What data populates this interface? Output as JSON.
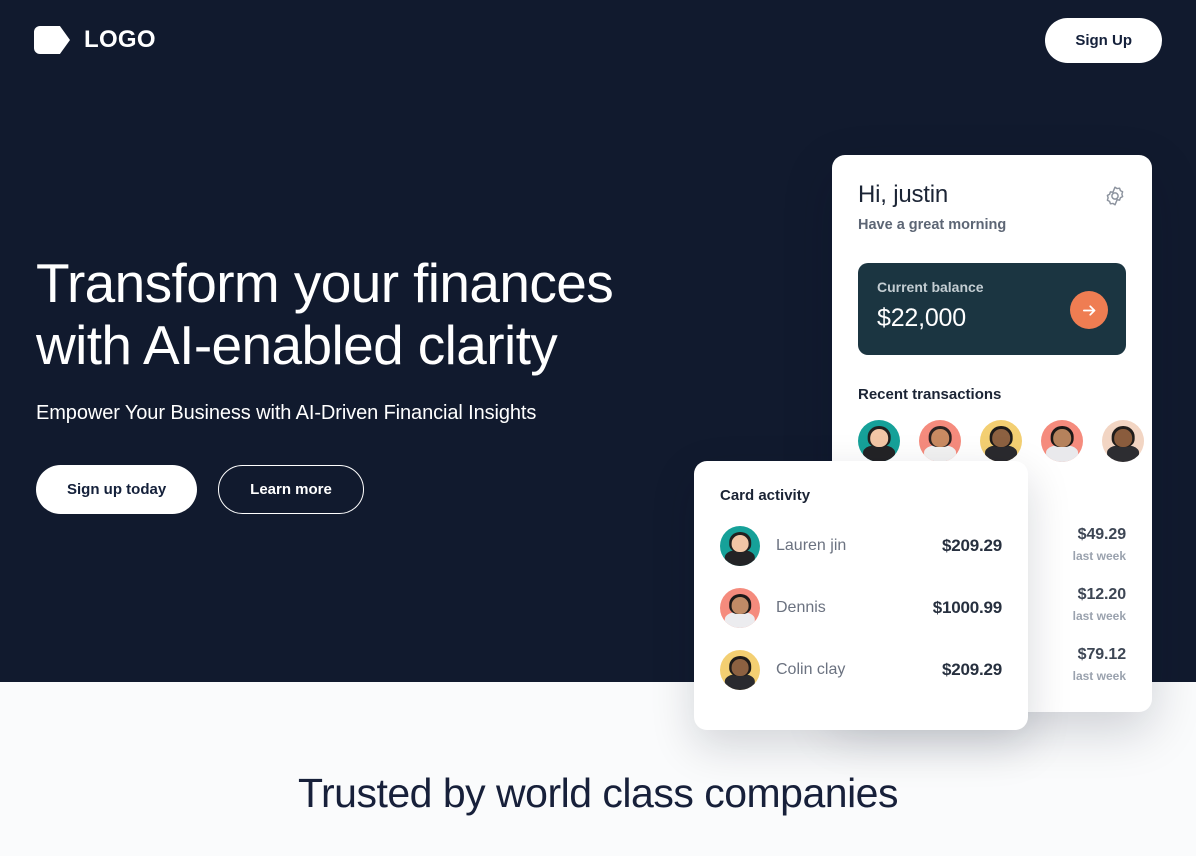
{
  "navbar": {
    "logo_icon": "tag-logo-icon",
    "brand_name": "LOGO",
    "signup_label": "Sign Up"
  },
  "hero": {
    "title_line1": "Transform your finances",
    "title_line2": "with AI-enabled clarity",
    "subtitle": "Empower Your Business with AI-Driven Financial Insights",
    "primary_cta": "Sign up today",
    "secondary_cta": "Learn more",
    "background_color": "#111a2e"
  },
  "dashboard_card": {
    "greeting": "Hi, justin",
    "greeting_sub": "Have a great morning",
    "settings_icon": "gear-icon",
    "balance": {
      "label": "Current balance",
      "value": "$22,000",
      "card_color": "#1b3541",
      "arrow_icon": "arrow-right-icon",
      "arrow_color": "#ef7d52"
    },
    "recent_title": "Recent transactions",
    "avatars": [
      {
        "name": "avatar-1",
        "bg": "#16a199",
        "skin": "#f2c6a6",
        "hair": "#22201f",
        "shirt": "#232326"
      },
      {
        "name": "avatar-2",
        "bg": "#f58b7d",
        "skin": "#c98b62",
        "hair": "#2b2322",
        "shirt": "#f2f2f2"
      },
      {
        "name": "avatar-3",
        "bg": "#f3cf72",
        "skin": "#8c6141",
        "hair": "#1d1b1a",
        "shirt": "#2a2a2e"
      },
      {
        "name": "avatar-4",
        "bg": "#f58b7d",
        "skin": "#b5825c",
        "hair": "#1b1817",
        "shirt": "#e9e9ec"
      },
      {
        "name": "avatar-5",
        "bg": "#f2d5c3",
        "skin": "#8a5c3d",
        "hair": "#211d1b",
        "shirt": "#2d2d31"
      }
    ],
    "amounts": [
      {
        "value": "$49.29",
        "note": "last week"
      },
      {
        "value": "$12.20",
        "note": "last week"
      },
      {
        "value": "$79.12",
        "note": "last week"
      }
    ]
  },
  "activity_card": {
    "title": "Card activity",
    "rows": [
      {
        "name": "Lauren jin",
        "amount": "$209.29",
        "avatar": {
          "name": "avatar-lauren",
          "bg": "#16a199",
          "skin": "#f2c6a6",
          "hair": "#22201f",
          "shirt": "#232326"
        }
      },
      {
        "name": "Dennis",
        "amount": "$1000.99",
        "avatar": {
          "name": "avatar-dennis",
          "bg": "#f58b7d",
          "skin": "#c08b66",
          "hair": "#1d1a19",
          "shirt": "#ececef"
        }
      },
      {
        "name": "Colin clay",
        "amount": "$209.29",
        "avatar": {
          "name": "avatar-colin",
          "bg": "#f3cf72",
          "skin": "#8c6141",
          "hair": "#1d1b1a",
          "shirt": "#2a2a2e"
        }
      }
    ]
  },
  "trusted": {
    "title": "Trusted by world class companies"
  }
}
